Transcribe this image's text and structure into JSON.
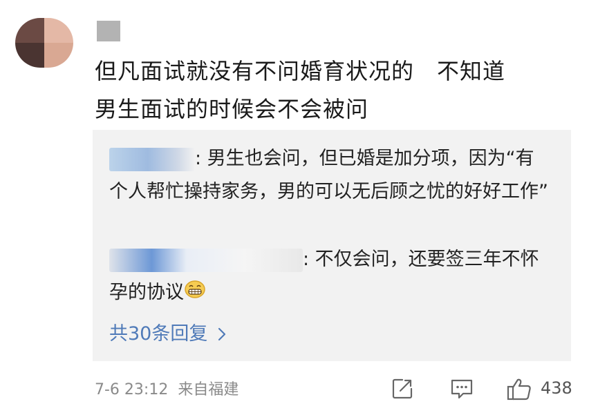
{
  "post": {
    "text_line1": "但凡面试就没有不问婚育状况的　不知道",
    "text_line2": "男生面试的时候会不会被问"
  },
  "replies": [
    {
      "text": ": 男生也会问，但已婚是加分项，因为“有个人帮忙操持家务，男的可以无后顾之忧的好好工作”"
    },
    {
      "text": ": 不仅会问，还要签三年不怀孕的协议",
      "emoji_name": "grin-emoji"
    }
  ],
  "more_replies_label": "共30条回复",
  "footer": {
    "date": "7-6 23:12",
    "source": "来自福建",
    "like_count": "438"
  },
  "icons": [
    "share-icon",
    "comment-icon",
    "like-icon",
    "chevron-right-icon",
    "grin-emoji"
  ],
  "colors": {
    "link": "#4f7ab8",
    "reply_bg": "#f2f2f2",
    "meta": "#8a8a8a"
  }
}
